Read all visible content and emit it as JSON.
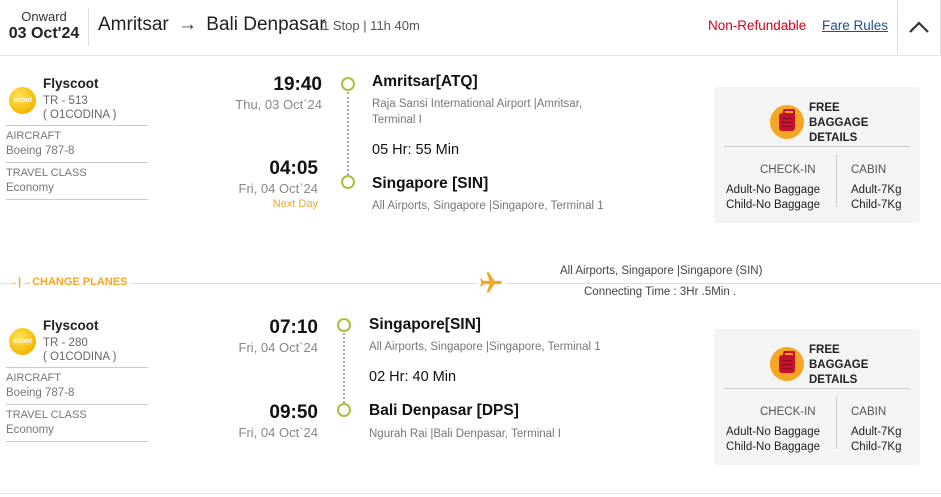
{
  "header": {
    "onward_label": "Onward",
    "onward_date": "03 Oct'24",
    "origin": "Amritsar",
    "route_arrow": "→",
    "destination": "Bali Denpasar",
    "stop_info": "1 Stop | 11h 40m",
    "non_refundable": "Non-Refundable",
    "fare_rules": "Fare Rules",
    "collapse_icon": "chevron-up-icon"
  },
  "colors": {
    "non_refundable": "#d0021b",
    "link": "#1f4e8c",
    "accent_orange": "#f5a623",
    "timeline_green": "#a5c23c"
  },
  "segments": [
    {
      "airline": "Flyscoot",
      "logo_text": "scoot",
      "flight_no": "TR - 513",
      "fare_code": "( O1CODINA )",
      "aircraft_label": "AIRCRAFT",
      "aircraft": "Boeing 787-8",
      "class_label": "TRAVEL CLASS",
      "travel_class": "Economy",
      "dep_time": "19:40",
      "dep_date": "Thu, 03 Oct`24",
      "arr_time": "04:05",
      "arr_date": "Fri, 04 Oct`24",
      "next_day": "Next Day",
      "dep_city": "Amritsar[ATQ]",
      "dep_airport": "Raja Sansi International Airport |Amritsar, Terminal I",
      "duration": "05 Hr: 55 Min",
      "arr_city": "Singapore [SIN]",
      "arr_airport": "All Airports, Singapore |Singapore, Terminal 1",
      "baggage": {
        "title": "FREE BAGGAGE DETAILS",
        "checkin_label": "CHECK-IN",
        "cabin_label": "CABIN",
        "checkin_adult": "Adult-No Baggage",
        "checkin_child": "Child-No Baggage",
        "cabin_adult": "Adult-7Kg",
        "cabin_child": "Child-7Kg"
      }
    },
    {
      "airline": "Flyscoot",
      "logo_text": "scoot",
      "flight_no": "TR - 280",
      "fare_code": "( O1CODINA )",
      "aircraft_label": "AIRCRAFT",
      "aircraft": "Boeing 787-8",
      "class_label": "TRAVEL CLASS",
      "travel_class": "Economy",
      "dep_time": "07:10",
      "dep_date": "Fri, 04 Oct`24",
      "arr_time": "09:50",
      "arr_date": "Fri, 04 Oct`24",
      "dep_city": "Singapore[SIN]",
      "dep_airport": "All Airports, Singapore |Singapore, Terminal 1",
      "duration": "02 Hr: 40 Min",
      "arr_city": "Bali Denpasar [DPS]",
      "arr_airport": "Ngurah Rai |Bali Denpasar, Terminal I",
      "baggage": {
        "title": "FREE BAGGAGE DETAILS",
        "checkin_label": "CHECK-IN",
        "cabin_label": "CABIN",
        "checkin_adult": "Adult-No Baggage",
        "checkin_child": "Child-No Baggage",
        "cabin_adult": "Adult-7Kg",
        "cabin_child": "Child-7Kg"
      }
    }
  ],
  "layover": {
    "change_planes": "→|→CHANGE PLANES",
    "airport": "All Airports, Singapore |Singapore (SIN)",
    "connecting_time": "Connecting Time : 3Hr .5Min ."
  }
}
